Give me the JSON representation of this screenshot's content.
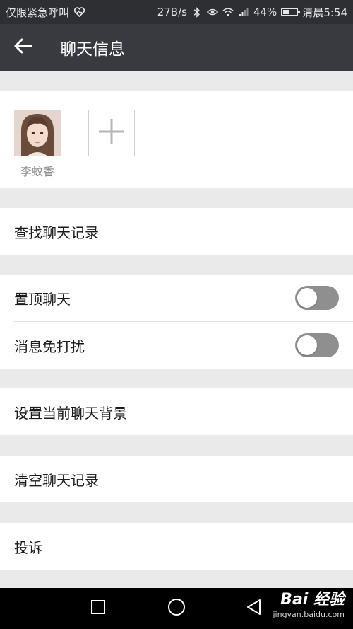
{
  "status_bar": {
    "carrier": "仅限紧急呼叫",
    "speed": "27B/s",
    "battery": "44%",
    "battery_level": 0.44,
    "time": "清晨5:54",
    "icons": [
      "heart-icon",
      "bluetooth-icon",
      "eye-icon",
      "wifi-icon",
      "signal-icon",
      "battery-icon"
    ]
  },
  "header": {
    "back_icon": "back-arrow-icon",
    "title": "聊天信息"
  },
  "members": {
    "items": [
      {
        "name": "李蚊香",
        "avatar": "avatar"
      }
    ],
    "add_icon": "plus-icon"
  },
  "rows": {
    "search_history": "查找聊天记录",
    "pin_chat": {
      "label": "置顶聊天",
      "on": false
    },
    "mute": {
      "label": "消息免打扰",
      "on": false
    },
    "set_background": "设置当前聊天背景",
    "clear_history": "清空聊天记录",
    "report": "投诉"
  },
  "nav_bar": {
    "icons": [
      "square-icon",
      "circle-icon",
      "triangle-back-icon"
    ]
  },
  "watermark": {
    "main": "Bai 经验",
    "sub": "jingyan.baidu.com"
  },
  "colors": {
    "title_bar": "#393a3f",
    "status_bar": "#2e2f32",
    "background": "#eaeaea",
    "toggle_off": "#8f8f8f"
  }
}
